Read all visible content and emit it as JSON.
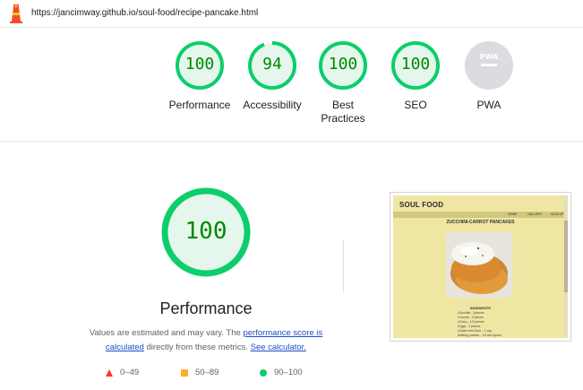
{
  "url": "https://jancimway.github.io/soul-food/recipe-pancake.html",
  "colors": {
    "pass": "#0cce6b",
    "pass_text": "#008800",
    "pass_bg": "#e5f7ec",
    "average": "#ffaa33",
    "fail": "#ff3333",
    "pwa_gray": "#cccccc",
    "link": "#1a4ec7"
  },
  "gauges": [
    {
      "score": "100",
      "label": "Performance",
      "value": 1.0
    },
    {
      "score": "94",
      "label": "Accessibility",
      "value": 0.94
    },
    {
      "score": "100",
      "label": "Best Practices",
      "value": 1.0
    },
    {
      "score": "100",
      "label": "SEO",
      "value": 1.0
    },
    {
      "score": "",
      "label": "PWA",
      "badge": "PWA",
      "icon": "pwa-badge-icon"
    }
  ],
  "main": {
    "score": "100",
    "title": "Performance",
    "desc_before": "Values are estimated and may vary. The ",
    "desc_link1": "performance score is calculated",
    "desc_middle": " directly from these metrics. ",
    "desc_link2": "See calculator."
  },
  "legend": [
    {
      "range": "0–49",
      "icon": "fail-triangle-icon"
    },
    {
      "range": "50–89",
      "icon": "average-square-icon"
    },
    {
      "range": "90–100",
      "icon": "pass-circle-icon"
    }
  ],
  "screenshot": {
    "brand": "SOUL FOOD",
    "nav": [
      "HOME",
      "GALLERY",
      "SIGN UP"
    ],
    "title": "ZUCCHINI-CARROT PANCAKES",
    "ingredients_heading": "INGIDIENTS",
    "ingredients": [
      "Zucchini - 2pieces",
      "Carrots - 3 pieces",
      "Onion - 1/2 pieces",
      "Eggs - 2 pieces",
      "Gluten free flour - 1 cup",
      "Baking powder - 1/2 tea spoon"
    ]
  }
}
